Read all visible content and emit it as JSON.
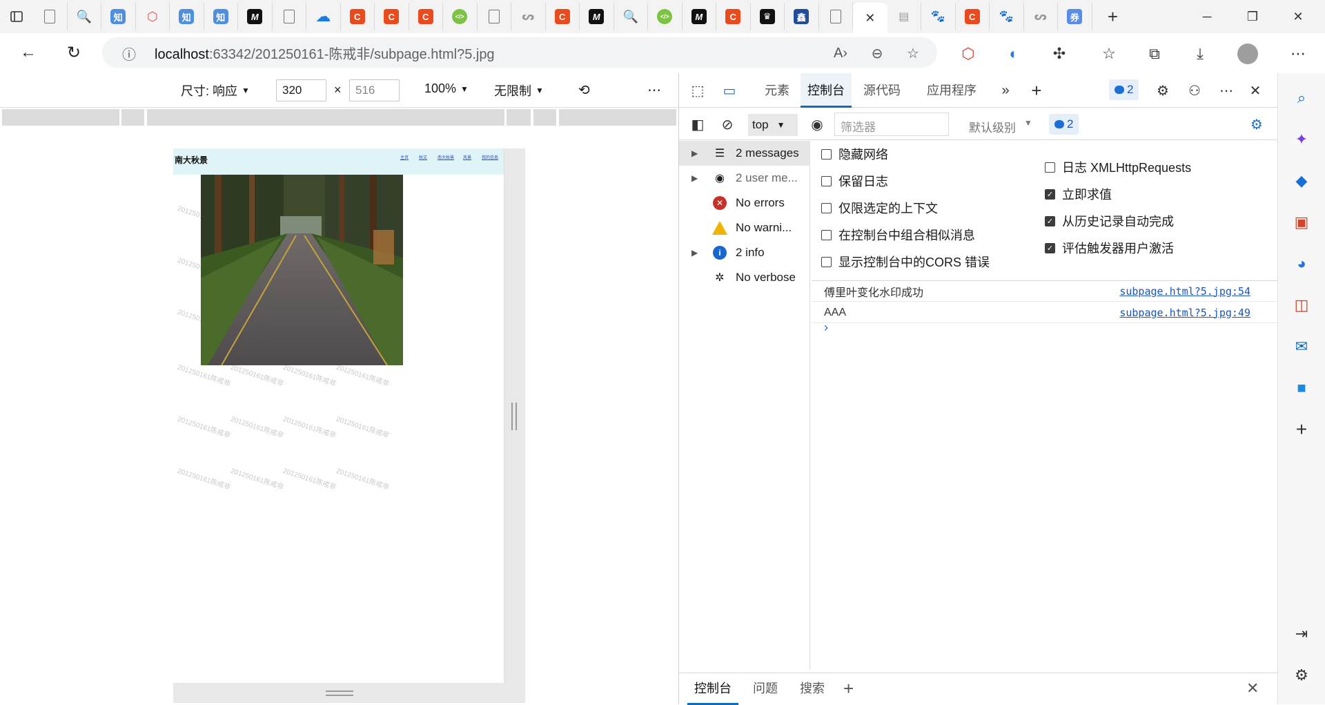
{
  "browser": {
    "tabs": [
      {
        "icon": "document-icon",
        "glyph": ""
      },
      {
        "icon": "search-icon",
        "glyph": "🔍"
      },
      {
        "icon": "zhihu-icon",
        "glyph": "知"
      },
      {
        "icon": "shield-icon",
        "glyph": "⬡"
      },
      {
        "icon": "zhihu-icon",
        "glyph": "知"
      },
      {
        "icon": "zhihu-icon",
        "glyph": "知"
      },
      {
        "icon": "m-logo-icon",
        "glyph": "M"
      },
      {
        "icon": "document-icon",
        "glyph": ""
      },
      {
        "icon": "onedrive-icon",
        "glyph": "☁"
      },
      {
        "icon": "csdn-icon",
        "glyph": "C"
      },
      {
        "icon": "csdn-icon",
        "glyph": "C"
      },
      {
        "icon": "csdn-icon",
        "glyph": "C"
      },
      {
        "icon": "code-icon",
        "glyph": "</>"
      },
      {
        "icon": "document-icon",
        "glyph": ""
      },
      {
        "icon": "feather-icon",
        "glyph": "ᔕ"
      },
      {
        "icon": "csdn-icon",
        "glyph": "C"
      },
      {
        "icon": "m-logo-icon",
        "glyph": "M"
      },
      {
        "icon": "search-icon",
        "glyph": "🔍"
      },
      {
        "icon": "code-icon",
        "glyph": "</>"
      },
      {
        "icon": "m-logo-icon",
        "glyph": "M"
      },
      {
        "icon": "csdn-icon",
        "glyph": "C"
      },
      {
        "icon": "chess-icon",
        "glyph": "♛"
      },
      {
        "icon": "xin-icon",
        "glyph": "鑫"
      },
      {
        "icon": "document-icon",
        "glyph": ""
      },
      {
        "icon": "close-icon",
        "glyph": "✕",
        "active": true
      },
      {
        "icon": "tabs-icon",
        "glyph": "▤"
      },
      {
        "icon": "baidu-paw-icon",
        "glyph": "🐾"
      },
      {
        "icon": "csdn-icon",
        "glyph": "C"
      },
      {
        "icon": "baidu-paw-icon",
        "glyph": "🐾"
      },
      {
        "icon": "feather-icon",
        "glyph": "ᔕ"
      },
      {
        "icon": "quan-icon",
        "glyph": "券"
      }
    ],
    "new_tab_glyph": "+",
    "address": {
      "host": "localhost",
      "rest": ":63342/201250161-陈戒非/subpage.html?5.jpg"
    }
  },
  "device_toolbar": {
    "size_label": "尺寸: 响应",
    "width": "320",
    "height_placeholder": "516",
    "zoom": "100%",
    "throttle": "无限制",
    "times": "×"
  },
  "page": {
    "site_title": "南大秋景",
    "nav_links": [
      "主页",
      "秋文",
      "南大秋景",
      "风景",
      "我的信息"
    ],
    "watermark": "201250161陈戒非"
  },
  "devtools": {
    "tabs": [
      "元素",
      "控制台",
      "源代码",
      "应用程序"
    ],
    "active_tab": "控制台",
    "issue_count": "2",
    "context": "top",
    "filter_placeholder": "筛选器",
    "level": "默认级别",
    "message_count": "2",
    "sidebar": [
      {
        "label": "2 messages",
        "icon": "list-icon",
        "arrow": true
      },
      {
        "label": "2 user me...",
        "icon": "user-icon",
        "arrow": true
      },
      {
        "label": "No errors",
        "icon": "error-icon",
        "arrow": false
      },
      {
        "label": "No warni...",
        "icon": "warning-icon",
        "arrow": false
      },
      {
        "label": "2 info",
        "icon": "info-icon",
        "arrow": true
      },
      {
        "label": "No verbose",
        "icon": "bug-icon",
        "arrow": false
      }
    ],
    "settings_left": [
      {
        "label": "隐藏网络",
        "checked": false
      },
      {
        "label": "保留日志",
        "checked": false
      },
      {
        "label": "仅限选定的上下文",
        "checked": false
      },
      {
        "label": "在控制台中组合相似消息",
        "checked": false
      },
      {
        "label": "显示控制台中的CORS 错误",
        "checked": false
      }
    ],
    "settings_right": [
      {
        "label": "日志 XMLHttpRequests",
        "checked": false
      },
      {
        "label": "立即求值",
        "checked": true
      },
      {
        "label": "从历史记录自动完成",
        "checked": true
      },
      {
        "label": "评估触发器用户激活",
        "checked": true
      }
    ],
    "logs": [
      {
        "message": "傅里叶变化水印成功",
        "source": "subpage.html?5.jpg:54"
      },
      {
        "message": "AAA",
        "source": "subpage.html?5.jpg:49"
      }
    ],
    "prompt": "›",
    "drawer_tabs": [
      "控制台",
      "问题",
      "搜索"
    ]
  }
}
